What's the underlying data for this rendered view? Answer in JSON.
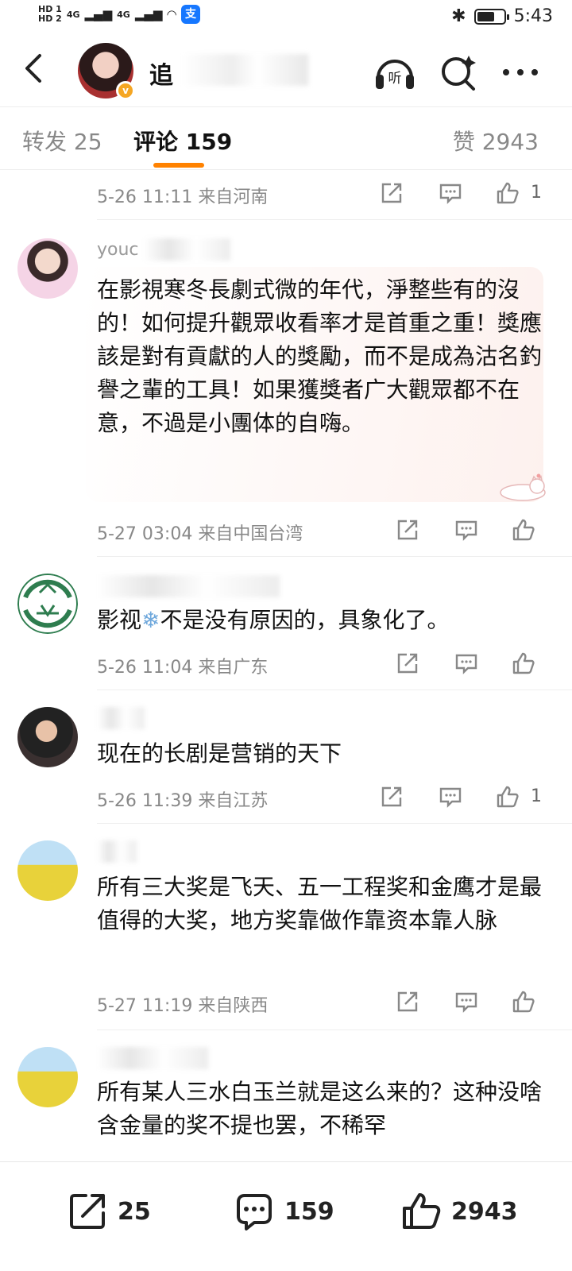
{
  "status_bar": {
    "hd1": "HD 1",
    "hd2": "HD 2",
    "net1": "4G",
    "net2": "4G",
    "alipay": "支",
    "time": "5:43",
    "battery_level": 0.7
  },
  "header": {
    "title": "追",
    "verified": "v"
  },
  "tabs": {
    "repost": "转发 25",
    "comment": "评论 159",
    "like": "赞 2943"
  },
  "comments": [
    {
      "meta": "5-26 11:11  来自河南",
      "likes": "1"
    },
    {
      "user": "youc",
      "text": "在影視寒冬長劇式微的年代，淨整些有的沒的！如何提升觀眾收看率才是首重之重！獎應該是對有貢獻的人的獎勵，而不是成為沽名釣譽之輩的工具！如果獲獎者广大觀眾都不在意，不過是小團体的自嗨。",
      "meta": "5-27 03:04  来自中国台湾",
      "likes": ""
    },
    {
      "user": "",
      "text_before": "影视",
      "emoji": "❄",
      "text_after": "不是没有原因的，具象化了。",
      "meta": "5-26 11:04  来自广东",
      "likes": ""
    },
    {
      "user": "",
      "text": "现在的长剧是营销的天下",
      "meta": "5-26 11:39  来自江苏",
      "likes": "1"
    },
    {
      "user": "",
      "text": "所有三大奖是飞天、五一工程奖和金鹰才是最值得的大奖，地方奖靠做作靠资本靠人脉",
      "meta": "5-27 11:19  来自陕西",
      "likes": ""
    },
    {
      "user": "",
      "text": "所有某人三水白玉兰就是这么来的？这种没啥含金量的奖不提也罢，不稀罕"
    }
  ],
  "bottom_bar": {
    "repost": "25",
    "comment": "159",
    "like": "2943"
  },
  "colors": {
    "accent": "#ff8200",
    "muted": "#888888",
    "bubble": "#fdf1ee"
  },
  "icons": [
    "back-arrow-icon",
    "listen-icon",
    "search-icon",
    "more-icon",
    "share-icon",
    "comment-icon",
    "like-icon"
  ]
}
